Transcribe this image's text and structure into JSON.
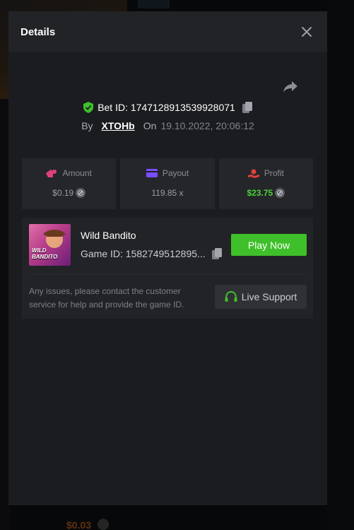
{
  "background": {
    "bottom_amount": "$0.03"
  },
  "modal": {
    "title": "Details",
    "bet_id_label": "Bet ID: 1747128913539928071",
    "by_label": "By",
    "username": "XTOHb",
    "on_label": "On",
    "date": "19.10.2022, 20:06:12"
  },
  "stats": {
    "amount_label": "Amount",
    "amount_value": "$0.19",
    "payout_label": "Payout",
    "payout_value": "119.85 x",
    "profit_label": "Profit",
    "profit_value": "$23.75"
  },
  "game": {
    "name": "Wild Bandito",
    "game_id": "Game ID: 1582749512895...",
    "thumb_label": "WILD BANDITO",
    "play_label": "Play Now",
    "help_text": "Any issues, please contact the customer service for help and provide the game ID.",
    "support_label": "Live Support"
  },
  "colors": {
    "accent_green": "#3fc02a",
    "profit_green": "#4cd137",
    "amount_icon": "#e0407a",
    "payout_icon": "#7b4dff",
    "profit_icon": "#e0403a"
  }
}
